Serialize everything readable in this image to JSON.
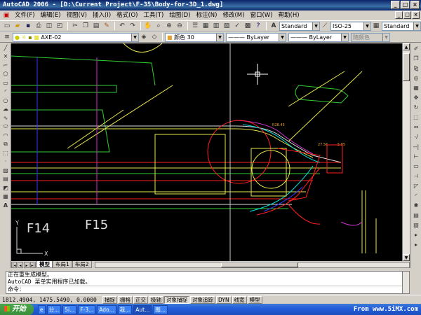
{
  "window": {
    "title": "AutoCAD 2006 - [D:\\Current Project\\F-35\\Body-for-3D_1.dwg]",
    "controls": [
      "_",
      "□",
      "×"
    ]
  },
  "menu": {
    "items": [
      "文件(F)",
      "编辑(E)",
      "视图(V)",
      "插入(I)",
      "格式(O)",
      "工具(T)",
      "绘图(D)",
      "标注(N)",
      "修改(M)",
      "窗口(W)",
      "帮助(H)"
    ],
    "doc_controls": [
      "_",
      "□",
      "×"
    ]
  },
  "styles_toolbar": {
    "text_style": "Standard",
    "dim_style": "ISO-25",
    "table_style": "Standard"
  },
  "layers_toolbar": {
    "layer": "AXE-02",
    "color": "颜色 30",
    "linetype": "ByLayer",
    "lineweight": "ByLayer",
    "plot_style": "随颜色"
  },
  "drawing": {
    "labels": {
      "f14": "F14",
      "f15": "F15",
      "ucs_y": "Y",
      "ucs_x": "X"
    },
    "dims": {
      "d1": "R28.45",
      "d2": "27.56",
      "d3": "5.85"
    },
    "colors": {
      "background": "#000000",
      "green": "#33cc33",
      "yellow": "#e6e64d",
      "cyan": "#00e5e5",
      "red": "#ff2020",
      "magenta": "#cc33cc",
      "blue": "#3333ff",
      "white": "#dddddd"
    }
  },
  "tabs": {
    "items": [
      "模型",
      "布局1",
      "布局2"
    ],
    "active": "模型"
  },
  "command": {
    "line1": "正在重生成模型。",
    "line2": "AutoCAD 菜单实用程序已加载。",
    "prompt": "命令："
  },
  "status": {
    "coords": "1812.4904, 1475.5490, 0.0000",
    "toggles": [
      "捕捉",
      "栅格",
      "正交",
      "极轴",
      "对象捕捉",
      "对象追踪",
      "DYN",
      "线宽",
      "模型"
    ]
  },
  "taskbar": {
    "start": "开始",
    "tasks": [
      "分...",
      "5i...",
      "F-3...",
      "Ado...",
      "我...",
      "Aut...",
      "图..."
    ],
    "watermark": "From www.5iMX.com"
  }
}
